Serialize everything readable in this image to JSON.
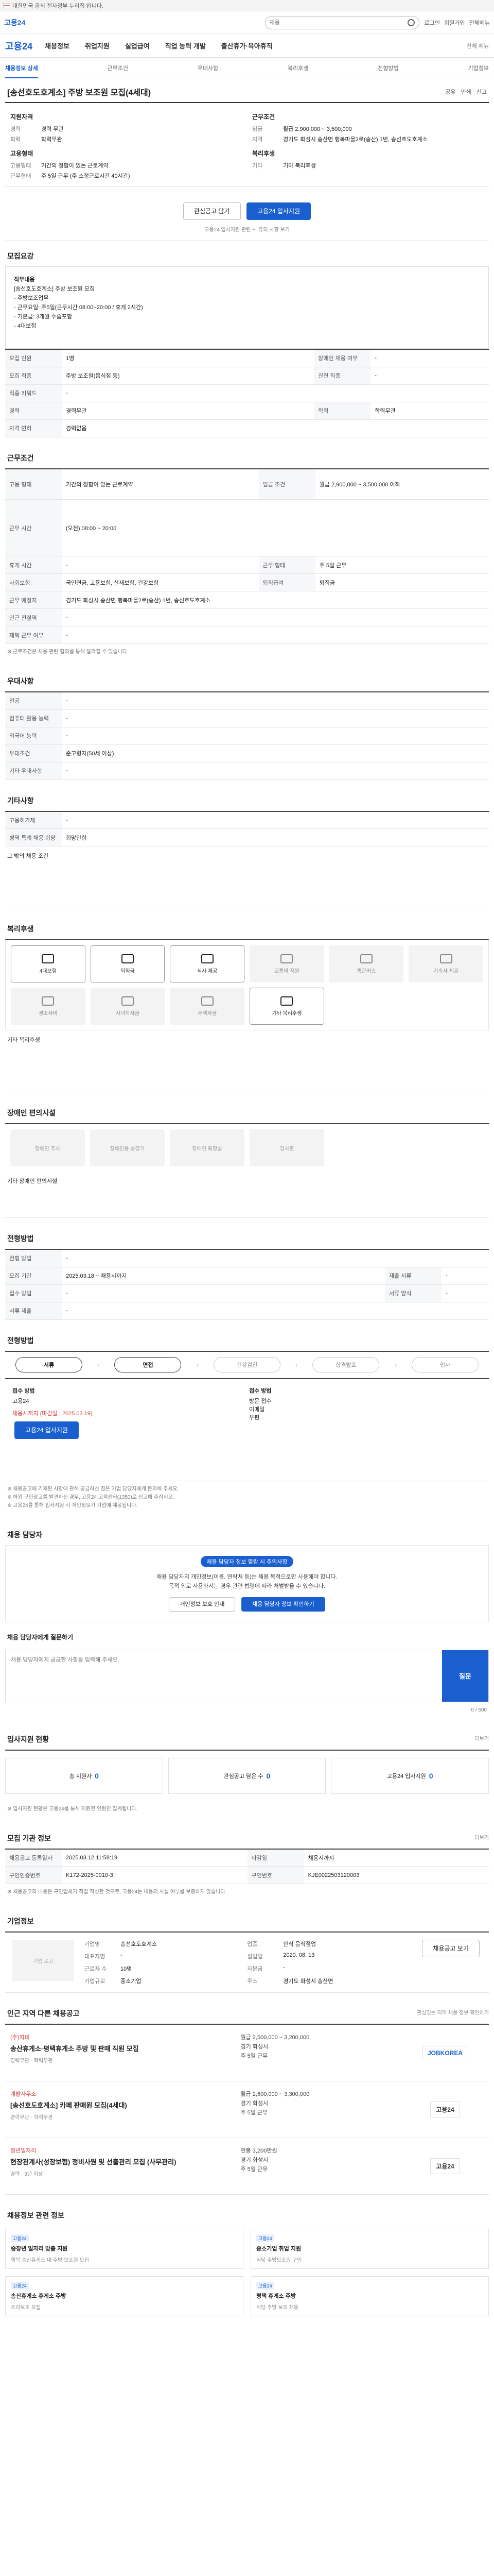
{
  "topbar": {
    "text": "대한민국 공식 전자정부 누리집 입니다."
  },
  "header": {
    "logo": "고용24",
    "search_placeholder": "채용",
    "links": [
      "로그인",
      "회원가입",
      "전체메뉴"
    ]
  },
  "gnb": {
    "logo": "고용24",
    "items": [
      "채용정보",
      "취업지원",
      "실업급여",
      "직업 능력 개발",
      "출산휴가·육아휴직"
    ],
    "right": "전체 메뉴"
  },
  "subnav": {
    "items": [
      "채용정보 상세",
      "근무조건",
      "우대사항",
      "복리후생",
      "전형방법",
      "기업정보"
    ]
  },
  "job": {
    "title": "[송선호도호계소] 주방 보조원 모집(4세대)",
    "actions": [
      "공유",
      "인쇄",
      "신고"
    ]
  },
  "summary": {
    "left_head": "지원자격",
    "left": [
      {
        "k": "경력",
        "v": "경력 무관"
      },
      {
        "k": "학력",
        "v": "학력무관"
      }
    ],
    "left_head2": "고용형태",
    "left2": [
      {
        "k": "고용형태",
        "v": "기간의 정함이 있는 근로계약"
      },
      {
        "k": "근무형태",
        "v": "주 5일 근무 (주 소정근로시간 40시간)"
      }
    ],
    "right_head": "근무조건",
    "right": [
      {
        "k": "임금",
        "v": "월급 2,900,000 ~ 3,500,000"
      },
      {
        "k": "지역",
        "v": "경기도 화성시 송산면 행복마을2로(송산) 1번, 송선호도호계소"
      }
    ],
    "right_head2": "복리후생",
    "right2": [
      {
        "k": "기타",
        "v": "기타 복리후생"
      }
    ]
  },
  "apply": {
    "save_label": "관심공고 담기",
    "apply_label": "고용24 입사지원",
    "note": "고용24 입사지원 관련 시 유의 사항 보기"
  },
  "recruit": {
    "title": "모집요강",
    "desc_lines": [
      "직무내용",
      "[송선호도호계소] 주방 보조원 모집",
      "- 주방보조업무",
      "- 근무요일: 주5일(근무시간 08:00~20:00 / 휴게 2시간)",
      "- 기본급: 3개월 수습포함",
      "- 4대보험"
    ],
    "rows": [
      {
        "k": "모집 인원",
        "v": "1명",
        "k2": "장애인 채용 여부",
        "v2": "-"
      },
      {
        "k": "모집 직종",
        "v": "주방 보조원(음식점 등)",
        "k2": "관련 직종",
        "v2": "-"
      },
      {
        "k": "직종 키워드",
        "v": "-",
        "k2": "",
        "v2": ""
      },
      {
        "k": "경력",
        "v": "경력무관",
        "k2": "학력",
        "v2": "학력무관"
      },
      {
        "k": "자격 면허",
        "v": "경력없음",
        "k2": "",
        "v2": ""
      }
    ]
  },
  "work": {
    "title": "근무조건",
    "rows": [
      {
        "k": "고용 형태",
        "v": "기간의 정함이 있는 근로계약",
        "k2": "임금 조건",
        "v2": "월급 2,900,000 ~ 3,500,000 이하"
      },
      {
        "k": "근무 시간",
        "v": "(오전) 08:00 ~ 20:00",
        "k2": "",
        "v2": ""
      },
      {
        "k": "휴게 시간",
        "v": "-",
        "k2": "근무 형태",
        "v2": "주 5일 근무"
      },
      {
        "k": "사회보험",
        "v": "국민연금, 고용보험, 산재보험, 건강보험",
        "k2": "퇴직급여",
        "v2": "퇴직금"
      },
      {
        "k": "근무 예정지",
        "v": "경기도 화성시 송산면 행복마을2로(송산) 1번, 송선호도호계소",
        "k2": "",
        "v2": ""
      },
      {
        "k": "인근 전철역",
        "v": "-",
        "k2": "",
        "v2": ""
      },
      {
        "k": "재택 근무 여부",
        "v": "-",
        "k2": "",
        "v2": ""
      }
    ],
    "note": "※ 근로조건은 채용 관련 협의를 통해 달라질 수 있습니다."
  },
  "prefer": {
    "title": "우대사항",
    "rows": [
      {
        "k": "전공",
        "v": "-"
      },
      {
        "k": "컴퓨터 활용 능력",
        "v": "-"
      },
      {
        "k": "외국어 능력",
        "v": "-"
      },
      {
        "k": "우대조건",
        "v": "준고령자(50세 이상)"
      },
      {
        "k": "기타 우대사항",
        "v": "-"
      }
    ]
  },
  "etc": {
    "title": "기타사항",
    "rows": [
      {
        "k": "고용허가제",
        "v": "-"
      },
      {
        "k": "병역 특례 채용 희망",
        "v": "희망안함"
      }
    ],
    "extra_title": "그 밖의 채용 조건"
  },
  "welfare": {
    "title": "복리후생",
    "items": [
      {
        "label": "4대보험",
        "on": true
      },
      {
        "label": "퇴직금",
        "on": true
      },
      {
        "label": "식사 제공",
        "on": true
      },
      {
        "label": "교통비 지원",
        "on": false
      },
      {
        "label": "통근버스",
        "on": false
      },
      {
        "label": "기숙사 제공",
        "on": false
      },
      {
        "label": "경조사비",
        "on": false
      },
      {
        "label": "자녀학자금",
        "on": false
      },
      {
        "label": "주택자금",
        "on": false
      },
      {
        "label": "기타 복리후생",
        "on": true
      }
    ],
    "extra_label": "기타 복리후생"
  },
  "disability": {
    "title": "장애인 편의시설",
    "items": [
      "장애인 주차",
      "장애인용 승강기",
      "장애인 화장실",
      "경사로"
    ],
    "extra_label": "기타 장애인 편의시설"
  },
  "selection": {
    "title": "전형방법",
    "rows": [
      {
        "k": "전형 방법",
        "v": "-"
      },
      {
        "k": "모집 기간",
        "v": "2025.03.18 ~ 채용시까지",
        "k2": "제출 서류",
        "v2": "-"
      },
      {
        "k": "접수 방법",
        "v": "-",
        "k2": "서류 양식",
        "v2": "-"
      },
      {
        "k": "서류 제출",
        "v": "-"
      }
    ]
  },
  "process": {
    "title": "전형방법",
    "steps": [
      {
        "label": "서류",
        "on": true
      },
      {
        "label": "면접",
        "on": true
      },
      {
        "label": "건강검진",
        "on": false
      },
      {
        "label": "합격발표",
        "on": false
      },
      {
        "label": "입사",
        "on": false
      }
    ]
  },
  "method": {
    "left_head": "접수 방법",
    "left_value": "고용24",
    "deadline": "채용시까지 (마감일 : 2025.03.19)",
    "apply_label": "고용24 입사지원",
    "right_head": "접수 방법",
    "right_items": [
      "방문 접수",
      "이메일",
      "우편"
    ]
  },
  "notices": [
    "※ 채용공고에 기재된 사항에 관해 궁금하신 점은 기업 담당자에게 문의해 주세요.",
    "※ 허위 구인광고를 발견하신 경우, 고용24 고객센터(1350)로 신고해 주십시오.",
    "※ 고용24를 통해 입사지원 시 개인정보가 기업에 제공됩니다."
  ],
  "counsel": {
    "title": "채용 담당자",
    "badge": "채용 담당자 정보 열람 시 주의사항",
    "text1": "채용 담당자의 개인정보(이름, 연락처 등)는 채용 목적으로만 사용해야 합니다.",
    "text2": "목적 외로 사용하시는 경우 관련 법령에 따라 처벌받을 수 있습니다.",
    "btn1": "개인정보 보호 안내",
    "btn2": "채용 담당자 정보 확인하기"
  },
  "qa": {
    "title": "채용 담당자에게 질문하기",
    "placeholder": "채용 담당자에게 궁금한 사항을 입력해 주세요.",
    "send_label": "질문",
    "counter": "0 / 500"
  },
  "stats": {
    "title": "입사지원 현황",
    "more": "더보기",
    "items": [
      {
        "label": "총 지원자",
        "value": "0"
      },
      {
        "label": "관심공고 담은 수",
        "value": "0"
      },
      {
        "label": "고용24 입사지원",
        "value": "0"
      }
    ],
    "note": "※ 입사지원 현황은 고용24를 통해 지원한 인원만 집계됩니다."
  },
  "recruit_info": {
    "title": "모집 기관 정보",
    "more": "더보기",
    "rows": [
      {
        "k": "채용공고 등록일자",
        "v": "2025.03.12 11:58:19",
        "k2": "마감일",
        "v2": "채용시까지"
      },
      {
        "k": "구인인증번호",
        "v": "K172-2025-0010-3",
        "k2": "구인번호",
        "v2": "KJE0022503120003"
      }
    ],
    "note": "※ 채용공고의 내용은 구인업체가 직접 작성한 것으로, 고용24는 내용의 사실 여부를 보증하지 않습니다."
  },
  "company": {
    "title": "기업정보",
    "logo_alt": "기업 로고",
    "apply_label": "채용공고 보기",
    "rows": [
      {
        "k": "기업명",
        "v": "송선호도호계소",
        "k2": "업종",
        "v2": "한식 음식점업"
      },
      {
        "k": "대표자명",
        "v": "-",
        "k2": "설립일",
        "v2": "2020. 08. 13"
      },
      {
        "k": "근로자 수",
        "v": "10명",
        "k2": "자본금",
        "v2": "-"
      },
      {
        "k": "기업규모",
        "v": "중소기업",
        "k2": "주소",
        "v2": "경기도 화성시 송산면"
      }
    ]
  },
  "similar": {
    "title": "인근 지역 다른 채용공고",
    "more": "관심있는 지역 채용 정보 확인하기",
    "cards": [
      {
        "co": "(주)지비",
        "title": "송산휴게소·평택휴게소 주방 및 판매 직원 모집",
        "meta": "경력무관 · 학력무관",
        "info": [
          "월급 2,500,000 ~ 3,200,000",
          "경기 화성시",
          "주 5일 근무"
        ],
        "brand": "JOBKOREA"
      },
      {
        "co": "개발사무소",
        "title": "[송선호도호계소] 카페 판매원 모집(4세대)",
        "meta": "경력무관 · 학력무관",
        "info": [
          "월급 2,600,000 ~ 3,300,000",
          "경기 화성시",
          "주 5일 근무"
        ],
        "brand": "고용24"
      },
      {
        "co": "청년일자리",
        "title": "현장관계사(성장보험) 정비사원 및 선출관리 모집 (사무관리)",
        "meta": "경력 · 3년 이상",
        "info": [
          "연봉 3,200만원",
          "경기 화성시",
          "주 5일 근무"
        ],
        "brand": "고용24"
      }
    ]
  },
  "sitejobs": {
    "title": "채용정보 관련 정보",
    "cards": [
      {
        "tag": "고용24",
        "title": "중장년 일자리 맞춤 지원",
        "meta": "행복 송산휴게소 내 주방 보조원 모집"
      },
      {
        "tag": "고용24",
        "title": "중소기업 취업 지원",
        "meta": "식당 주방보조원 구인"
      },
      {
        "tag": "고용24",
        "title": "송산휴게소 휴게소 주방",
        "meta": "조리보조 모집"
      },
      {
        "tag": "고용24",
        "title": "평택 휴게소 주방",
        "meta": "식당 주방 보조 채용"
      }
    ]
  }
}
